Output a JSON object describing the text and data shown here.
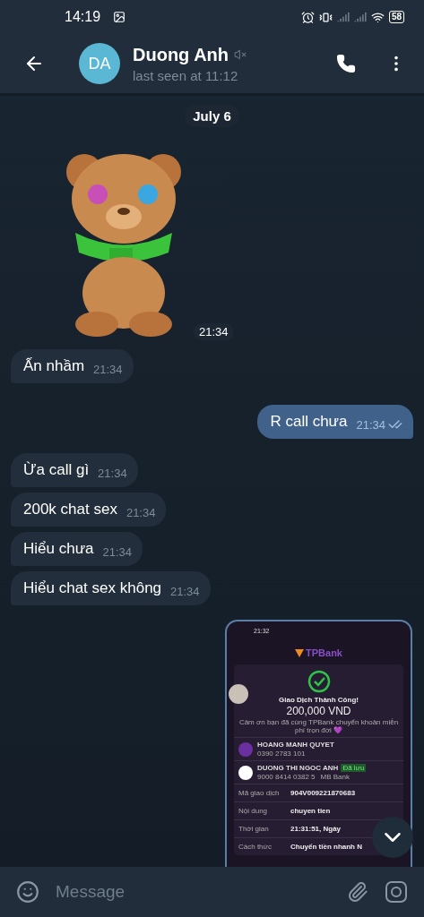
{
  "status_bar": {
    "time": "14:19",
    "battery": "58"
  },
  "header": {
    "avatar_initials": "DA",
    "name": "Duong Anh",
    "muted": true,
    "status": "last seen at 11:12"
  },
  "date_separator": "July 6",
  "messages": [
    {
      "kind": "sticker",
      "outgoing": false,
      "time": "21:34"
    },
    {
      "kind": "text",
      "outgoing": false,
      "text": "Ấn nhầm",
      "time": "21:34"
    },
    {
      "kind": "text",
      "outgoing": true,
      "text": "R call chưa",
      "time": "21:34",
      "read": true
    },
    {
      "kind": "text",
      "outgoing": false,
      "text": "Ừa call gì",
      "time": "21:34"
    },
    {
      "kind": "text",
      "outgoing": false,
      "text": "200k chat sex",
      "time": "21:34"
    },
    {
      "kind": "text",
      "outgoing": false,
      "text": "Hiểu chưa",
      "time": "21:34"
    },
    {
      "kind": "text",
      "outgoing": false,
      "text": "Hiểu chat sex không",
      "time": "21:34"
    },
    {
      "kind": "screenshot",
      "outgoing": true
    }
  ],
  "bank_screenshot": {
    "time": "21:32",
    "logo": "TPBank",
    "title": "Giao Dịch Thành Công!",
    "amount": "200,000 VND",
    "note": "Cảm ơn bạn đã cùng TPBank chuyển khoản miễn phí trọn đời 💜",
    "sender": {
      "name": "HOANG MANH QUYET",
      "account": "0390 2783 101"
    },
    "receiver": {
      "name": "DUONG THI NGOC ANH",
      "tag": "Đã lưu",
      "account": "9000 8414 0382 5",
      "bank": "MB Bank"
    },
    "rows": [
      {
        "label": "Mã giao dịch",
        "value": "904V009221870683"
      },
      {
        "label": "Nội dung",
        "value": "chuyen tien"
      },
      {
        "label": "Thời gian",
        "value": "21:31:51, Ngày"
      },
      {
        "label": "Cách thức",
        "value": "Chuyển tiền nhanh N"
      }
    ]
  },
  "composer": {
    "placeholder": "Message"
  }
}
